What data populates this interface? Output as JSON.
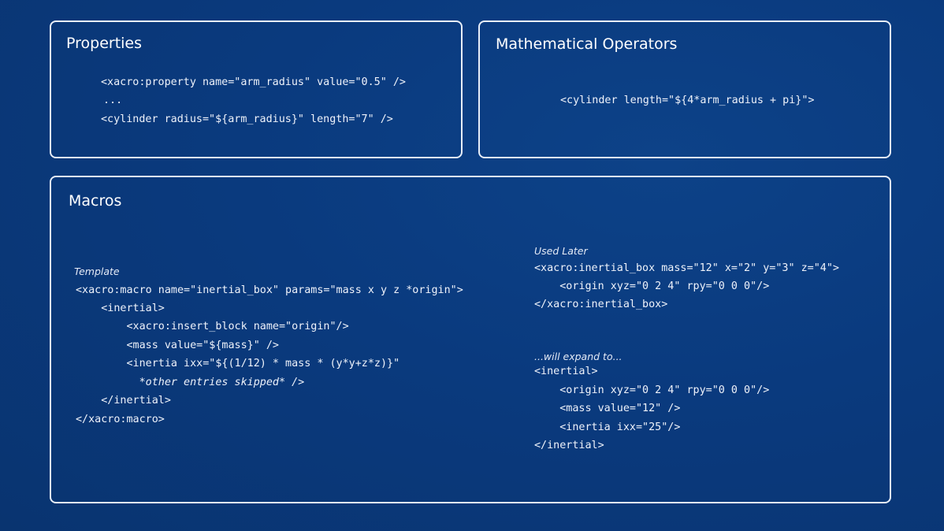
{
  "properties": {
    "title": "Properties",
    "lines": [
      "<xacro:property name=\"arm_radius\" value=\"0.5\" />",
      "...",
      "<cylinder radius=\"${arm_radius}\" length=\"7\" />"
    ]
  },
  "math": {
    "title": "Mathematical Operators",
    "lines": [
      "<cylinder length=\"${4*arm_radius + pi}\">"
    ]
  },
  "macros": {
    "title": "Macros",
    "template": {
      "label": "Template",
      "lines": [
        "<xacro:macro name=\"inertial_box\" params=\"mass x y z *origin\">",
        "    <inertial>",
        "        <xacro:insert_block name=\"origin\"/>",
        "        <mass value=\"${mass}\" />",
        "        <inertia ixx=\"${(1/12) * mass * (y*y+z*z)}\"",
        "          *other entries skipped* />",
        "    </inertial>",
        "</xacro:macro>"
      ]
    },
    "used_later": {
      "label": "Used Later",
      "lines": [
        "<xacro:inertial_box mass=\"12\" x=\"2\" y=\"3\" z=\"4\">",
        "    <origin xyz=\"0 2 4\" rpy=\"0 0 0\"/>",
        "</xacro:inertial_box>"
      ]
    },
    "expand": {
      "label": "...will expand to...",
      "lines": [
        "<inertial>",
        "    <origin xyz=\"0 2 4\" rpy=\"0 0 0\"/>",
        "    <mass value=\"12\" />",
        "    <inertia ixx=\"25\"/>",
        "</inertial>"
      ]
    }
  }
}
